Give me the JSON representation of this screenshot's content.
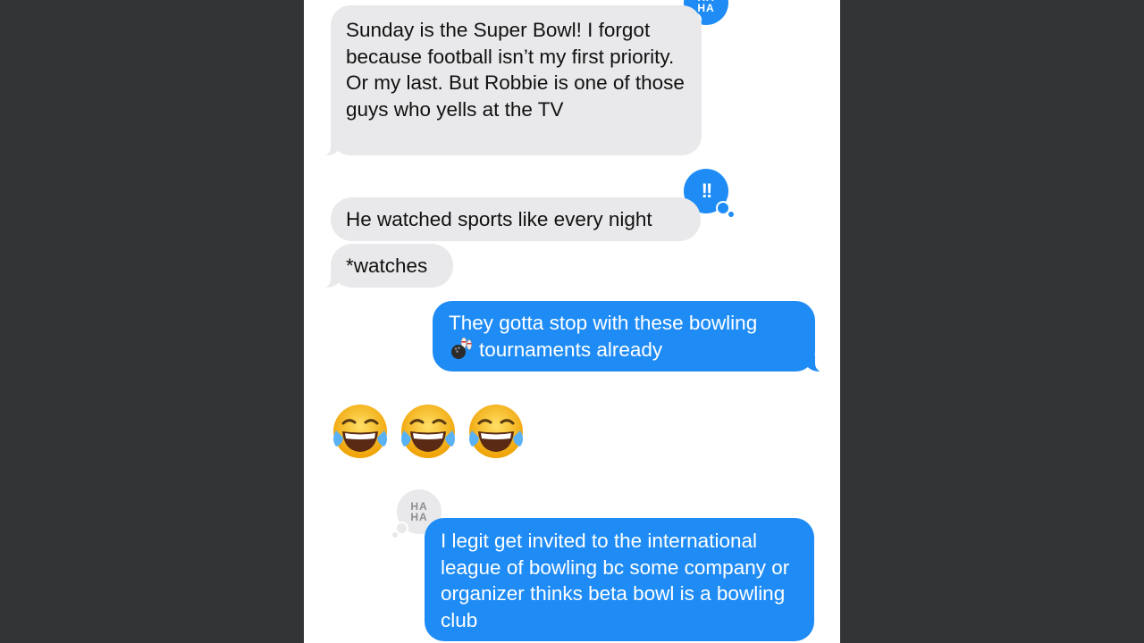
{
  "colors": {
    "page_background": "#333436",
    "thread_background": "#ffffff",
    "received_bubble": "#e9e9eb",
    "sent_bubble": "#1f8cf5"
  },
  "messages": [
    {
      "from": "them",
      "text": "Sunday is the Super Bowl! I forgot because football isn’t my first priority. Or my last. But Robbie is one of those guys who yells at the TV",
      "tapback": "haha"
    },
    {
      "from": "them",
      "text": "He watched sports like every night",
      "tapback": "exclamation"
    },
    {
      "from": "them",
      "text": "*watches"
    },
    {
      "from": "me",
      "text": "tournaments already",
      "text_line1": "They gotta stop with these bowling",
      "inline_emoji": "bowling-emoji"
    },
    {
      "from": "them",
      "emoji": [
        "face-with-tears-of-joy",
        "face-with-tears-of-joy",
        "face-with-tears-of-joy"
      ]
    },
    {
      "from": "me",
      "text": "I legit get invited to the international league of bowling bc some company or organizer thinks beta bowl is a bowling club",
      "tapback": "haha"
    }
  ],
  "tapbacks": {
    "haha_label_top": "HA",
    "haha_label_bottom": "HA",
    "exclamation_label": "!!"
  }
}
